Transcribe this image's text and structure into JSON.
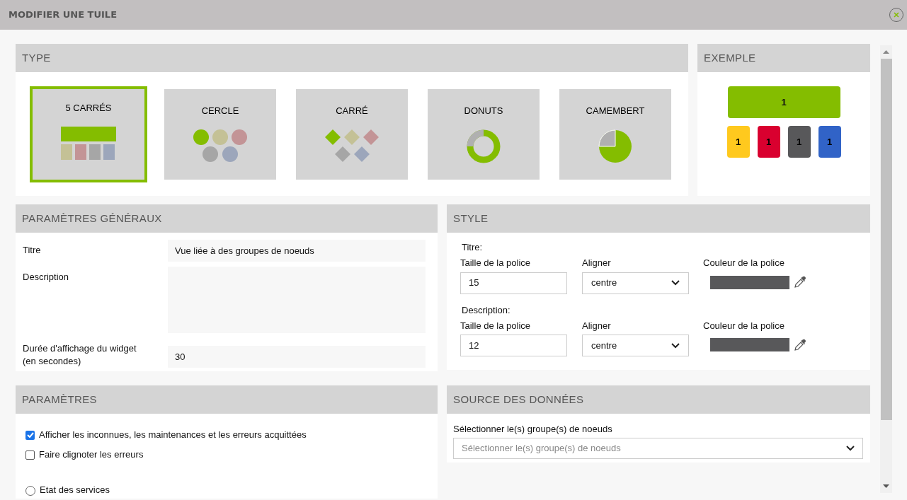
{
  "window": {
    "title": "MODIFIER UNE TUILE"
  },
  "type_panel": {
    "title": "TYPE",
    "tiles": [
      {
        "label": "5 CARRÉS",
        "kind": "five_squares",
        "selected": true
      },
      {
        "label": "CERCLE",
        "kind": "circles",
        "selected": false
      },
      {
        "label": "CARRÉ",
        "kind": "diamonds",
        "selected": false
      },
      {
        "label": "DONUTS",
        "kind": "donut",
        "selected": false
      },
      {
        "label": "CAMEMBERT",
        "kind": "pie",
        "selected": false
      }
    ]
  },
  "example": {
    "title": "EXEMPLE",
    "main": {
      "value": "1",
      "color": "#84bd00"
    },
    "cells": [
      {
        "value": "1",
        "color": "#ffc91e"
      },
      {
        "value": "1",
        "color": "#d9002f"
      },
      {
        "value": "1",
        "color": "#58585a"
      },
      {
        "value": "1",
        "color": "#3163c7"
      }
    ]
  },
  "general": {
    "title": "PARAMÈTRES GÉNÉRAUX",
    "fields": [
      {
        "label": "Titre",
        "kind": "input",
        "value": "Vue liée à des groupes de noeuds"
      },
      {
        "label": "Description",
        "kind": "textarea"
      },
      {
        "label": "Durée d'affichage du widget (en secondes)",
        "kind": "input",
        "value": "30"
      }
    ]
  },
  "style": {
    "title": "STYLE",
    "groups": [
      {
        "heading": "Titre:",
        "size_label": "Taille de la police",
        "size": "15",
        "align_label": "Aligner",
        "align": "centre",
        "color_label": "Couleur de la police",
        "color": "#58585a"
      },
      {
        "heading": "Description:",
        "size_label": "Taille de la police",
        "size": "12",
        "align_label": "Aligner",
        "align": "centre",
        "color_label": "Couleur de la police",
        "color": "#58585a"
      }
    ]
  },
  "parameters": {
    "title": "PARAMÈTRES",
    "options": [
      {
        "kind": "checkbox",
        "label": "Afficher les inconnues, les maintenances et les erreurs acquittées",
        "checked": true
      },
      {
        "kind": "checkbox",
        "label": "Faire clignoter les erreurs",
        "checked": false
      },
      {
        "kind": "radio",
        "label": "Etat des services",
        "selected": false
      }
    ]
  },
  "source": {
    "title": "SOURCE DES DONNÉES",
    "label": "Sélectionner le(s) groupe(s) de noeuds",
    "placeholder": "Sélectionner le(s) groupe(s) de noeuds"
  }
}
